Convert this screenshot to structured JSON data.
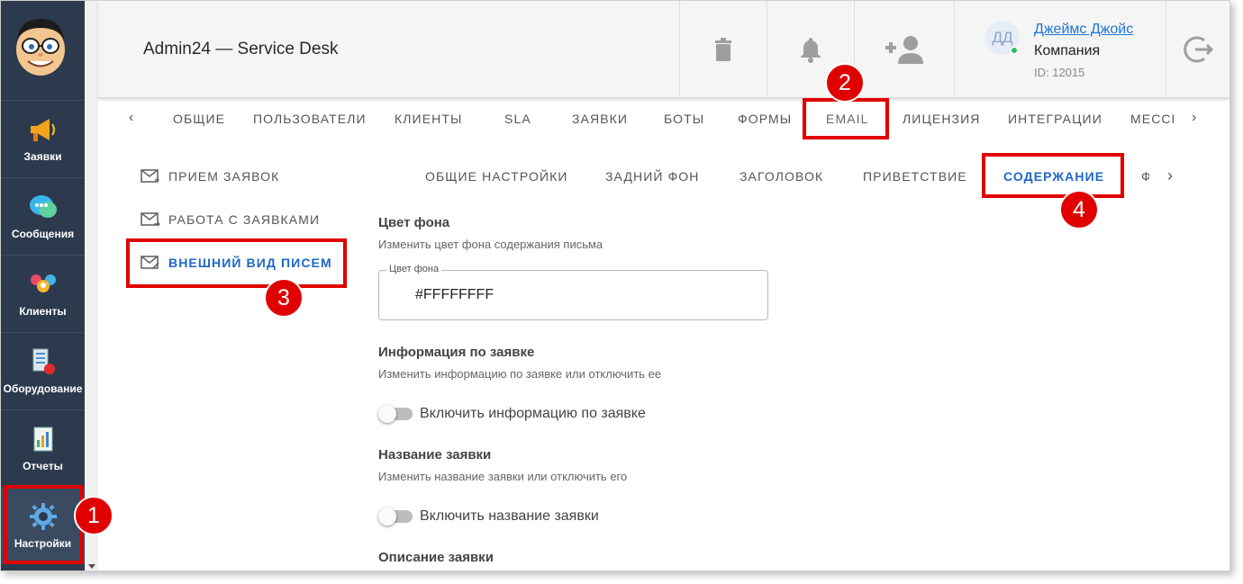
{
  "app": {
    "title": "Admin24 — Service Desk"
  },
  "sidebar": {
    "items": [
      {
        "label": "Заявки",
        "icon": "megaphone-icon"
      },
      {
        "label": "Сообщения",
        "icon": "chat-icon"
      },
      {
        "label": "Клиенты",
        "icon": "clients-icon"
      },
      {
        "label": "Оборудование",
        "icon": "equipment-icon"
      },
      {
        "label": "Отчеты",
        "icon": "report-icon"
      },
      {
        "label": "Настройки",
        "icon": "gear-icon"
      }
    ]
  },
  "user": {
    "initials": "ДД",
    "name": "Джеймс Джойс",
    "company": "Компания",
    "id": "ID: 12015"
  },
  "tabs": [
    "ОБЩИЕ",
    "ПОЛЬЗОВАТЕЛИ",
    "КЛИЕНТЫ",
    "SLA",
    "ЗАЯВКИ",
    "БОТЫ",
    "ФОРМЫ",
    "EMAIL",
    "ЛИЦЕНЗИЯ",
    "ИНТЕГРАЦИИ",
    "МЕССЕ"
  ],
  "left_menu": [
    "ПРИЕМ ЗАЯВОК",
    "РАБОТА С ЗАЯВКАМИ",
    "ВНЕШНИЙ ВИД ПИСЕМ"
  ],
  "sub_tabs": [
    "ОБЩИЕ НАСТРОЙКИ",
    "ЗАДНИЙ ФОН",
    "ЗАГОЛОВОК",
    "ПРИВЕТСТВИЕ",
    "СОДЕРЖАНИЕ",
    "Ф"
  ],
  "content": {
    "bg": {
      "title": "Цвет фона",
      "desc": "Изменить цвет фона содержания письма",
      "field_label": "Цвет фона",
      "field_value": "#FFFFFFFF"
    },
    "info": {
      "title": "Информация по заявке",
      "desc": "Изменить информацию по заявке или отключить ее",
      "toggle": "Включить информацию по заявке",
      "enabled": false
    },
    "name": {
      "title": "Название заявки",
      "desc": "Изменить название заявки или отключить его",
      "toggle": "Включить название заявки",
      "enabled": false
    },
    "desc": {
      "title": "Описание заявки"
    }
  },
  "annotations": [
    "1",
    "2",
    "3",
    "4"
  ],
  "colors": {
    "sidebar": "#2d3a4d",
    "accent": "#1e67c8",
    "annotation": "#e00000"
  }
}
